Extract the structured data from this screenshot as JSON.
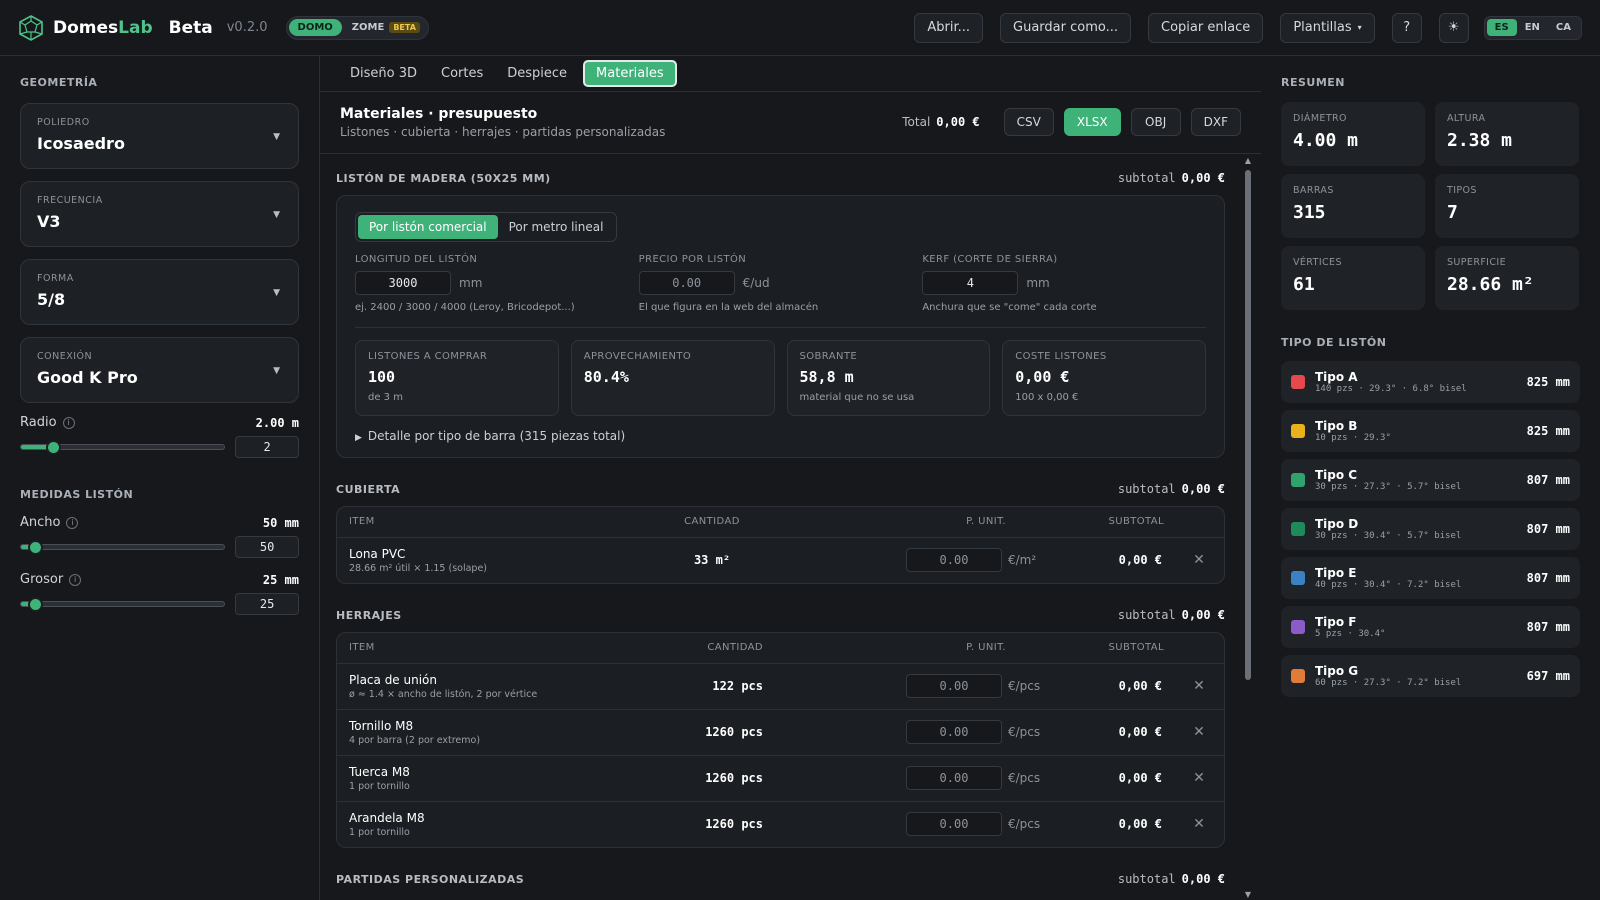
{
  "header": {
    "brand_part1": "Domes",
    "brand_part2": "Lab",
    "beta": "Beta",
    "version": "v0.2.0",
    "mode_domo": "DOMO",
    "mode_zome": "ZOME",
    "zome_badge": "BETA",
    "btn_open": "Abrir...",
    "btn_save_as": "Guardar como...",
    "btn_copy_link": "Copiar enlace",
    "btn_templates": "Plantillas",
    "btn_help": "?",
    "btn_theme": "☀",
    "langs": [
      "ES",
      "EN",
      "CA"
    ],
    "accent": "#3fb27a"
  },
  "left": {
    "geometry_title": "GEOMETRÍA",
    "selects": [
      {
        "label": "POLIEDRO",
        "value": "Icosaedro"
      },
      {
        "label": "FRECUENCIA",
        "value": "V3"
      },
      {
        "label": "FORMA",
        "value": "5/8"
      },
      {
        "label": "CONEXIÓN",
        "value": "Good K Pro"
      }
    ],
    "radius": {
      "label": "Radio",
      "value": "2.00 m",
      "input": "2",
      "level": 0.16
    },
    "measures_title": "MEDIDAS LISTÓN",
    "width": {
      "label": "Ancho",
      "value": "50 mm",
      "input": "50",
      "level": 0.07
    },
    "thickness": {
      "label": "Grosor",
      "value": "25 mm",
      "input": "25",
      "level": 0.07
    }
  },
  "tabs": [
    "Diseño 3D",
    "Cortes",
    "Despiece",
    "Materiales"
  ],
  "materials": {
    "title": "Materiales · presupuesto",
    "subtitle": "Listones · cubierta · herrajes · partidas personalizadas",
    "total_label": "Total",
    "total_value": "0,00 €",
    "exports": [
      "CSV",
      "XLSX",
      "OBJ",
      "DXF"
    ]
  },
  "liston": {
    "title": "LISTÓN DE MADERA (50X25 MM)",
    "subtotal_label": "subtotal",
    "subtotal": "0,00 €",
    "seg_commercial": "Por listón comercial",
    "seg_linear": "Por metro lineal",
    "fields": [
      {
        "label": "LONGITUD DEL LISTÓN",
        "value": "3000",
        "unit": "mm",
        "help": "ej. 2400 / 3000 / 4000 (Leroy, Bricodepot...)"
      },
      {
        "label": "PRECIO POR LISTÓN",
        "value": "0.00",
        "unit": "€/ud",
        "help": "El que figura en la web del almacén"
      },
      {
        "label": "KERF (CORTE DE SIERRA)",
        "value": "4",
        "unit": "mm",
        "help": "Anchura que se \"come\" cada corte"
      }
    ],
    "stats": [
      {
        "label": "LISTONES A COMPRAR",
        "value": "100",
        "help": "de 3 m"
      },
      {
        "label": "APROVECHAMIENTO",
        "value": "80.4%",
        "help": ""
      },
      {
        "label": "SOBRANTE",
        "value": "58,8 m",
        "help": "material que no se usa"
      },
      {
        "label": "COSTE LISTONES",
        "value": "0,00 €",
        "help": "100 x 0,00 €"
      }
    ],
    "detail": "Detalle por tipo de barra (315 piezas total)"
  },
  "cubierta": {
    "title": "CUBIERTA",
    "subtotal_label": "subtotal",
    "subtotal": "0,00 €",
    "headers": [
      "ITEM",
      "CANTIDAD",
      "P. UNIT.",
      "SUBTOTAL"
    ],
    "rows": [
      {
        "name": "Lona PVC",
        "note": "28.66 m² útil × 1.15 (solape)",
        "qty": "33 m²",
        "price": "0.00",
        "unit": "€/m²",
        "subtotal": "0,00 €"
      }
    ]
  },
  "herrajes": {
    "title": "HERRAJES",
    "subtotal_label": "subtotal",
    "subtotal": "0,00 €",
    "headers": [
      "ITEM",
      "CANTIDAD",
      "P. UNIT.",
      "SUBTOTAL"
    ],
    "rows": [
      {
        "name": "Placa de unión",
        "note": "ø ≈ 1.4 × ancho de listón, 2 por vértice",
        "qty": "122 pcs",
        "price": "0.00",
        "unit": "€/pcs",
        "subtotal": "0,00 €"
      },
      {
        "name": "Tornillo M8",
        "note": "4 por barra (2 por extremo)",
        "qty": "1260 pcs",
        "price": "0.00",
        "unit": "€/pcs",
        "subtotal": "0,00 €"
      },
      {
        "name": "Tuerca M8",
        "note": "1 por tornillo",
        "qty": "1260 pcs",
        "price": "0.00",
        "unit": "€/pcs",
        "subtotal": "0,00 €"
      },
      {
        "name": "Arandela M8",
        "note": "1 por tornillo",
        "qty": "1260 pcs",
        "price": "0.00",
        "unit": "€/pcs",
        "subtotal": "0,00 €"
      }
    ]
  },
  "custom": {
    "title": "PARTIDAS PERSONALIZADAS",
    "subtotal_label": "subtotal",
    "subtotal": "0,00 €"
  },
  "right": {
    "summary_title": "RESUMEN",
    "summary": [
      {
        "label": "DIÁMETRO",
        "value": "4.00 m"
      },
      {
        "label": "ALTURA",
        "value": "2.38 m"
      },
      {
        "label": "BARRAS",
        "value": "315"
      },
      {
        "label": "TIPOS",
        "value": "7"
      },
      {
        "label": "VÉRTICES",
        "value": "61"
      },
      {
        "label": "SUPERFICIE",
        "value": "28.66 m²"
      }
    ],
    "types_title": "TIPO DE LISTÓN",
    "types": [
      {
        "name": "Tipo A",
        "desc": "140 pzs · 29.3° · 6.8° bisel",
        "length": "825 mm",
        "color": "#e5484d"
      },
      {
        "name": "Tipo B",
        "desc": "10 pzs · 29.3°",
        "length": "825 mm",
        "color": "#e9b11b"
      },
      {
        "name": "Tipo C",
        "desc": "30 pzs · 27.3° · 5.7° bisel",
        "length": "807 mm",
        "color": "#2fa36b"
      },
      {
        "name": "Tipo D",
        "desc": "30 pzs · 30.4° · 5.7° bisel",
        "length": "807 mm",
        "color": "#1f8a5a"
      },
      {
        "name": "Tipo E",
        "desc": "40 pzs · 30.4° · 7.2° bisel",
        "length": "807 mm",
        "color": "#3b82c4"
      },
      {
        "name": "Tipo F",
        "desc": "5 pzs · 30.4°",
        "length": "807 mm",
        "color": "#8b5cc7"
      },
      {
        "name": "Tipo G",
        "desc": "60 pzs · 27.3° · 7.2° bisel",
        "length": "697 mm",
        "color": "#e07b3a"
      }
    ]
  }
}
